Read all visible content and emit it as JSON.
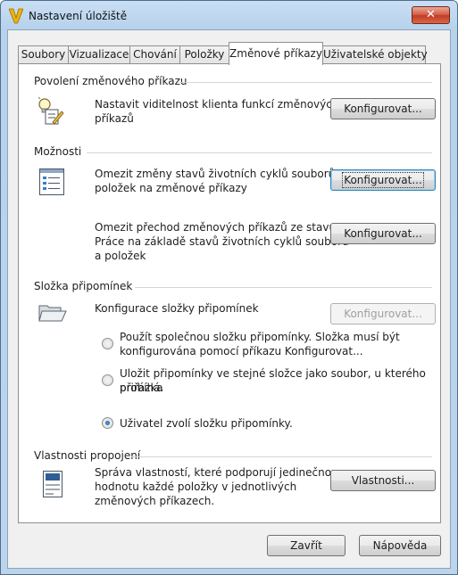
{
  "window": {
    "title": "Nastavení úložiště",
    "close_label": "✕"
  },
  "tabs": [
    {
      "label": "Soubory",
      "active": false
    },
    {
      "label": "Vizualizace",
      "active": false
    },
    {
      "label": "Chování",
      "active": false
    },
    {
      "label": "Položky",
      "active": false
    },
    {
      "label": "Změnové příkazy",
      "active": true
    },
    {
      "label": "Uživatelské objekty",
      "active": false
    }
  ],
  "sections": {
    "enable": {
      "title": "Povolení změnového příkazu",
      "text_line1": "Nastavit viditelnost klienta funkcí změnových",
      "text_line2": "příkazů",
      "button": "Konfigurovat...",
      "icon": "lightbulb-checklist-icon"
    },
    "options": {
      "title": "Možnosti",
      "item1_line1": "Omezit změny stavů životních cyklů souborů a",
      "item1_line2": "položek na změnové příkazy",
      "item1_button": "Konfigurovat...",
      "item2_line1": "Omezit přechod změnových příkazů ze stavu",
      "item2_line2": "Práce na základě stavů životních cyklů souborů",
      "item2_line3": "a položek",
      "item2_button": "Konfigurovat...",
      "icon": "list-options-icon"
    },
    "markup": {
      "title": "Složka připomínek",
      "config_label": "Konfigurace složky připomínek",
      "button": "Konfigurovat...",
      "radio1_line1": "Použít společnou složku připomínky. Složka musí být",
      "radio1_line2": "konfigurována pomocí příkazu Konfigurovat...",
      "radio2_line1": "Uložit připomínky ve stejné složce jako soubor, u kterého přiřázka",
      "radio2_line2": "probíhá.",
      "radio3_label": "Uživatel zvolí složku připomínky.",
      "selected_option": 3,
      "icon": "open-folder-icon"
    },
    "properties": {
      "title": "Vlastnosti propojení",
      "text_line1": "Správa vlastností, které podporují jedinečnou",
      "text_line2": "hodnotu každé položky v jednotlivých",
      "text_line3": "změnových příkazech.",
      "button": "Vlastnosti...",
      "icon": "property-sheet-icon"
    }
  },
  "footer": {
    "close_button": "Zavřít",
    "help_button": "Nápověda"
  },
  "colors": {
    "titlebar": "#bcd4ec",
    "close_button": "#c94a30",
    "panel": "#ffffff",
    "accent": "#f0b400"
  }
}
